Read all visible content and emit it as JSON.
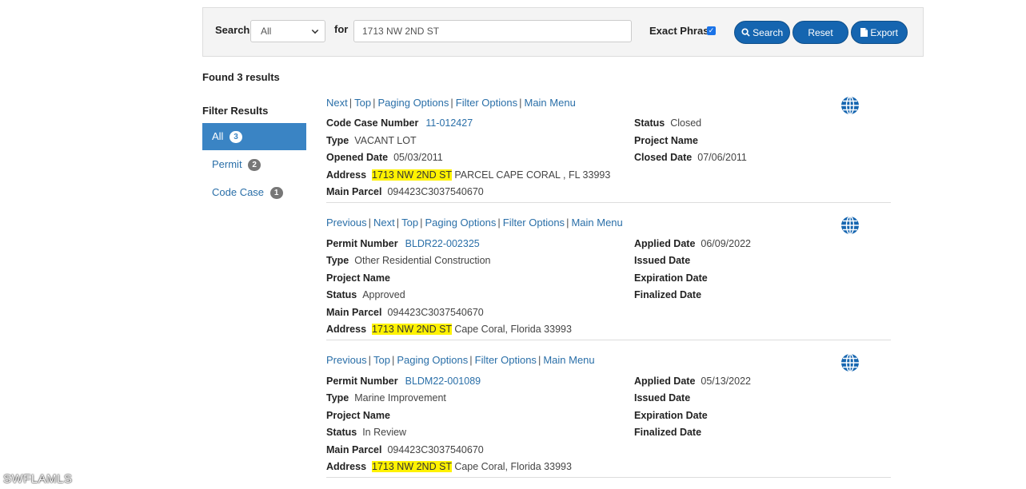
{
  "search": {
    "search_label": "Search",
    "scope_value": "All",
    "for_label": "for",
    "query_value": "1713 NW 2ND ST",
    "exact_phrase_label": "Exact Phrase",
    "exact_phrase_checked": true,
    "search_button": "Search",
    "reset_button": "Reset",
    "export_button": "Export"
  },
  "found_text": "Found 3 results",
  "filter": {
    "title": "Filter Results",
    "items": [
      {
        "label": "All",
        "count": "3",
        "active": true
      },
      {
        "label": "Permit",
        "count": "2",
        "active": false
      },
      {
        "label": "Code Case",
        "count": "1",
        "active": false
      }
    ]
  },
  "results": [
    {
      "nav": [
        "Next",
        "Top",
        "Paging Options",
        "Filter Options",
        "Main Menu"
      ],
      "left": [
        {
          "label": "Code Case Number",
          "value": "11-012427",
          "link": true
        },
        {
          "label": "Type",
          "value": "VACANT LOT"
        },
        {
          "label": "Opened Date",
          "value": "05/03/2011"
        },
        {
          "label": "Address",
          "highlight": "1713 NW 2ND ST",
          "value": "PARCEL CAPE CORAL , FL 33993"
        },
        {
          "label": "Main Parcel",
          "value": "094423C3037540670"
        }
      ],
      "right": [
        {
          "label": "Status",
          "value": "Closed"
        },
        {
          "label": "Project Name",
          "value": ""
        },
        {
          "label": "Closed Date",
          "value": "07/06/2011"
        }
      ]
    },
    {
      "nav": [
        "Previous",
        "Next",
        "Top",
        "Paging Options",
        "Filter Options",
        "Main Menu"
      ],
      "left": [
        {
          "label": "Permit Number",
          "value": "BLDR22-002325",
          "link": true
        },
        {
          "label": "Type",
          "value": "Other Residential Construction"
        },
        {
          "label": "Project Name",
          "value": ""
        },
        {
          "label": "Status",
          "value": "Approved"
        },
        {
          "label": "Main Parcel",
          "value": "094423C3037540670"
        },
        {
          "label": "Address",
          "highlight": "1713 NW 2ND ST",
          "value": "Cape Coral, Florida 33993"
        }
      ],
      "right": [
        {
          "label": "Applied Date",
          "value": "06/09/2022"
        },
        {
          "label": "Issued Date",
          "value": ""
        },
        {
          "label": "Expiration Date",
          "value": ""
        },
        {
          "label": "Finalized Date",
          "value": ""
        }
      ]
    },
    {
      "nav": [
        "Previous",
        "Top",
        "Paging Options",
        "Filter Options",
        "Main Menu"
      ],
      "left": [
        {
          "label": "Permit Number",
          "value": "BLDM22-001089",
          "link": true
        },
        {
          "label": "Type",
          "value": "Marine Improvement"
        },
        {
          "label": "Project Name",
          "value": ""
        },
        {
          "label": "Status",
          "value": "In Review"
        },
        {
          "label": "Main Parcel",
          "value": "094423C3037540670"
        },
        {
          "label": "Address",
          "highlight": "1713 NW 2ND ST",
          "value": "Cape Coral, Florida 33993"
        }
      ],
      "right": [
        {
          "label": "Applied Date",
          "value": "05/13/2022"
        },
        {
          "label": "Issued Date",
          "value": ""
        },
        {
          "label": "Expiration Date",
          "value": ""
        },
        {
          "label": "Finalized Date",
          "value": ""
        }
      ]
    }
  ],
  "watermark": "SWFLAMLS",
  "colors": {
    "accent": "#1565b0",
    "link": "#2a6fa8",
    "highlight": "#fff200",
    "active_filter": "#3a84c4"
  }
}
